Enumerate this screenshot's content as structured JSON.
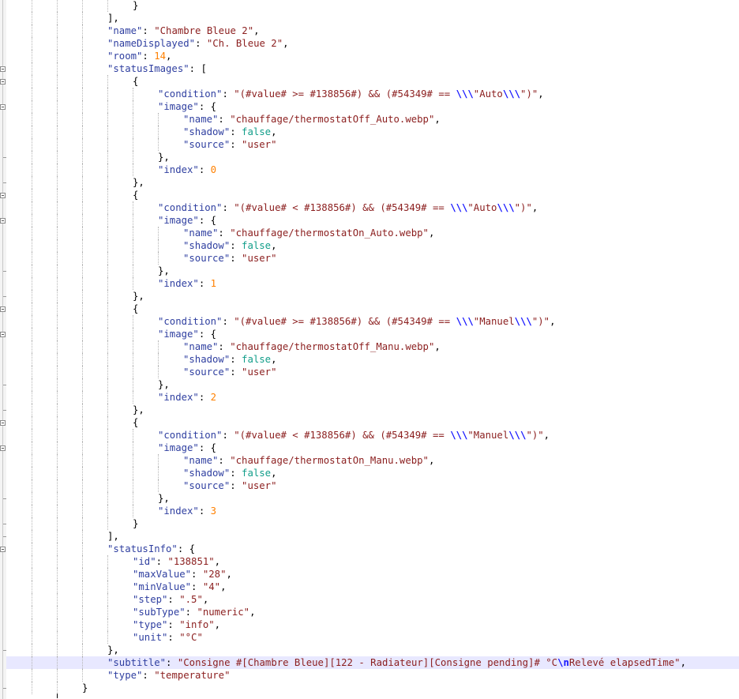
{
  "editor": {
    "language": "json",
    "lines": [
      {
        "fold": "none",
        "hl": false,
        "tokens": [
          {
            "t": "p",
            "v": "}"
          }
        ]
      },
      {
        "fold": "none",
        "hl": false,
        "tokens": [
          {
            "t": "p",
            "v": "],"
          }
        ]
      },
      {
        "fold": "none",
        "hl": false,
        "tokens": [
          {
            "t": "k",
            "v": "\"name\""
          },
          {
            "t": "p",
            "v": ": "
          },
          {
            "t": "s",
            "v": "\"Chambre Bleue 2\""
          },
          {
            "t": "p",
            "v": ","
          }
        ]
      },
      {
        "fold": "none",
        "hl": false,
        "tokens": [
          {
            "t": "k",
            "v": "\"nameDisplayed\""
          },
          {
            "t": "p",
            "v": ": "
          },
          {
            "t": "s",
            "v": "\"Ch. Bleue 2\""
          },
          {
            "t": "p",
            "v": ","
          }
        ]
      },
      {
        "fold": "none",
        "hl": false,
        "tokens": [
          {
            "t": "k",
            "v": "\"room\""
          },
          {
            "t": "p",
            "v": ": "
          },
          {
            "t": "n",
            "v": "14"
          },
          {
            "t": "p",
            "v": ","
          }
        ]
      },
      {
        "fold": "open",
        "hl": false,
        "tokens": [
          {
            "t": "k",
            "v": "\"statusImages\""
          },
          {
            "t": "p",
            "v": ": ["
          }
        ]
      },
      {
        "fold": "open",
        "hl": false,
        "tokens": [
          {
            "t": "p",
            "v": "{"
          }
        ]
      },
      {
        "fold": "none",
        "hl": false,
        "tokens": [
          {
            "t": "k",
            "v": "\"condition\""
          },
          {
            "t": "p",
            "v": ": "
          },
          {
            "t": "s",
            "v": "\"(#value# >= #138856#) && (#54349# == "
          },
          {
            "t": "e",
            "v": "\\\\\\"
          },
          {
            "t": "s",
            "v": "\"Auto"
          },
          {
            "t": "e",
            "v": "\\\\\\"
          },
          {
            "t": "s",
            "v": "\")\""
          },
          {
            "t": "p",
            "v": ","
          }
        ]
      },
      {
        "fold": "open",
        "hl": false,
        "tokens": [
          {
            "t": "k",
            "v": "\"image\""
          },
          {
            "t": "p",
            "v": ": {"
          }
        ]
      },
      {
        "fold": "none",
        "hl": false,
        "tokens": [
          {
            "t": "k",
            "v": "\"name\""
          },
          {
            "t": "p",
            "v": ": "
          },
          {
            "t": "s",
            "v": "\"chauffage/thermostatOff_Auto.webp\""
          },
          {
            "t": "p",
            "v": ","
          }
        ]
      },
      {
        "fold": "none",
        "hl": false,
        "tokens": [
          {
            "t": "k",
            "v": "\"shadow\""
          },
          {
            "t": "p",
            "v": ": "
          },
          {
            "t": "b",
            "v": "false"
          },
          {
            "t": "p",
            "v": ","
          }
        ]
      },
      {
        "fold": "none",
        "hl": false,
        "tokens": [
          {
            "t": "k",
            "v": "\"source\""
          },
          {
            "t": "p",
            "v": ": "
          },
          {
            "t": "s",
            "v": "\"user\""
          }
        ]
      },
      {
        "fold": "close",
        "hl": false,
        "tokens": [
          {
            "t": "p",
            "v": "},"
          }
        ]
      },
      {
        "fold": "none",
        "hl": false,
        "tokens": [
          {
            "t": "k",
            "v": "\"index\""
          },
          {
            "t": "p",
            "v": ": "
          },
          {
            "t": "n",
            "v": "0"
          }
        ]
      },
      {
        "fold": "close",
        "hl": false,
        "tokens": [
          {
            "t": "p",
            "v": "},"
          }
        ]
      },
      {
        "fold": "open",
        "hl": false,
        "tokens": [
          {
            "t": "p",
            "v": "{"
          }
        ]
      },
      {
        "fold": "none",
        "hl": false,
        "tokens": [
          {
            "t": "k",
            "v": "\"condition\""
          },
          {
            "t": "p",
            "v": ": "
          },
          {
            "t": "s",
            "v": "\"(#value# < #138856#) && (#54349# == "
          },
          {
            "t": "e",
            "v": "\\\\\\"
          },
          {
            "t": "s",
            "v": "\"Auto"
          },
          {
            "t": "e",
            "v": "\\\\\\"
          },
          {
            "t": "s",
            "v": "\")\""
          },
          {
            "t": "p",
            "v": ","
          }
        ]
      },
      {
        "fold": "open",
        "hl": false,
        "tokens": [
          {
            "t": "k",
            "v": "\"image\""
          },
          {
            "t": "p",
            "v": ": {"
          }
        ]
      },
      {
        "fold": "none",
        "hl": false,
        "tokens": [
          {
            "t": "k",
            "v": "\"name\""
          },
          {
            "t": "p",
            "v": ": "
          },
          {
            "t": "s",
            "v": "\"chauffage/thermostatOn_Auto.webp\""
          },
          {
            "t": "p",
            "v": ","
          }
        ]
      },
      {
        "fold": "none",
        "hl": false,
        "tokens": [
          {
            "t": "k",
            "v": "\"shadow\""
          },
          {
            "t": "p",
            "v": ": "
          },
          {
            "t": "b",
            "v": "false"
          },
          {
            "t": "p",
            "v": ","
          }
        ]
      },
      {
        "fold": "none",
        "hl": false,
        "tokens": [
          {
            "t": "k",
            "v": "\"source\""
          },
          {
            "t": "p",
            "v": ": "
          },
          {
            "t": "s",
            "v": "\"user\""
          }
        ]
      },
      {
        "fold": "close",
        "hl": false,
        "tokens": [
          {
            "t": "p",
            "v": "},"
          }
        ]
      },
      {
        "fold": "none",
        "hl": false,
        "tokens": [
          {
            "t": "k",
            "v": "\"index\""
          },
          {
            "t": "p",
            "v": ": "
          },
          {
            "t": "n",
            "v": "1"
          }
        ]
      },
      {
        "fold": "close",
        "hl": false,
        "tokens": [
          {
            "t": "p",
            "v": "},"
          }
        ]
      },
      {
        "fold": "open",
        "hl": false,
        "tokens": [
          {
            "t": "p",
            "v": "{"
          }
        ]
      },
      {
        "fold": "none",
        "hl": false,
        "tokens": [
          {
            "t": "k",
            "v": "\"condition\""
          },
          {
            "t": "p",
            "v": ": "
          },
          {
            "t": "s",
            "v": "\"(#value# >= #138856#) && (#54349# == "
          },
          {
            "t": "e",
            "v": "\\\\\\"
          },
          {
            "t": "s",
            "v": "\"Manuel"
          },
          {
            "t": "e",
            "v": "\\\\\\"
          },
          {
            "t": "s",
            "v": "\")\""
          },
          {
            "t": "p",
            "v": ","
          }
        ]
      },
      {
        "fold": "open",
        "hl": false,
        "tokens": [
          {
            "t": "k",
            "v": "\"image\""
          },
          {
            "t": "p",
            "v": ": {"
          }
        ]
      },
      {
        "fold": "none",
        "hl": false,
        "tokens": [
          {
            "t": "k",
            "v": "\"name\""
          },
          {
            "t": "p",
            "v": ": "
          },
          {
            "t": "s",
            "v": "\"chauffage/thermostatOff_Manu.webp\""
          },
          {
            "t": "p",
            "v": ","
          }
        ]
      },
      {
        "fold": "none",
        "hl": false,
        "tokens": [
          {
            "t": "k",
            "v": "\"shadow\""
          },
          {
            "t": "p",
            "v": ": "
          },
          {
            "t": "b",
            "v": "false"
          },
          {
            "t": "p",
            "v": ","
          }
        ]
      },
      {
        "fold": "none",
        "hl": false,
        "tokens": [
          {
            "t": "k",
            "v": "\"source\""
          },
          {
            "t": "p",
            "v": ": "
          },
          {
            "t": "s",
            "v": "\"user\""
          }
        ]
      },
      {
        "fold": "close",
        "hl": false,
        "tokens": [
          {
            "t": "p",
            "v": "},"
          }
        ]
      },
      {
        "fold": "none",
        "hl": false,
        "tokens": [
          {
            "t": "k",
            "v": "\"index\""
          },
          {
            "t": "p",
            "v": ": "
          },
          {
            "t": "n",
            "v": "2"
          }
        ]
      },
      {
        "fold": "close",
        "hl": false,
        "tokens": [
          {
            "t": "p",
            "v": "},"
          }
        ]
      },
      {
        "fold": "open",
        "hl": false,
        "tokens": [
          {
            "t": "p",
            "v": "{"
          }
        ]
      },
      {
        "fold": "none",
        "hl": false,
        "tokens": [
          {
            "t": "k",
            "v": "\"condition\""
          },
          {
            "t": "p",
            "v": ": "
          },
          {
            "t": "s",
            "v": "\"(#value# < #138856#) && (#54349# == "
          },
          {
            "t": "e",
            "v": "\\\\\\"
          },
          {
            "t": "s",
            "v": "\"Manuel"
          },
          {
            "t": "e",
            "v": "\\\\\\"
          },
          {
            "t": "s",
            "v": "\")\""
          },
          {
            "t": "p",
            "v": ","
          }
        ]
      },
      {
        "fold": "open",
        "hl": false,
        "tokens": [
          {
            "t": "k",
            "v": "\"image\""
          },
          {
            "t": "p",
            "v": ": {"
          }
        ]
      },
      {
        "fold": "none",
        "hl": false,
        "tokens": [
          {
            "t": "k",
            "v": "\"name\""
          },
          {
            "t": "p",
            "v": ": "
          },
          {
            "t": "s",
            "v": "\"chauffage/thermostatOn_Manu.webp\""
          },
          {
            "t": "p",
            "v": ","
          }
        ]
      },
      {
        "fold": "none",
        "hl": false,
        "tokens": [
          {
            "t": "k",
            "v": "\"shadow\""
          },
          {
            "t": "p",
            "v": ": "
          },
          {
            "t": "b",
            "v": "false"
          },
          {
            "t": "p",
            "v": ","
          }
        ]
      },
      {
        "fold": "none",
        "hl": false,
        "tokens": [
          {
            "t": "k",
            "v": "\"source\""
          },
          {
            "t": "p",
            "v": ": "
          },
          {
            "t": "s",
            "v": "\"user\""
          }
        ]
      },
      {
        "fold": "close",
        "hl": false,
        "tokens": [
          {
            "t": "p",
            "v": "},"
          }
        ]
      },
      {
        "fold": "none",
        "hl": false,
        "tokens": [
          {
            "t": "k",
            "v": "\"index\""
          },
          {
            "t": "p",
            "v": ": "
          },
          {
            "t": "n",
            "v": "3"
          }
        ]
      },
      {
        "fold": "close",
        "hl": false,
        "tokens": [
          {
            "t": "p",
            "v": "}"
          }
        ]
      },
      {
        "fold": "close",
        "hl": false,
        "tokens": [
          {
            "t": "p",
            "v": "],"
          }
        ]
      },
      {
        "fold": "open",
        "hl": false,
        "tokens": [
          {
            "t": "k",
            "v": "\"statusInfo\""
          },
          {
            "t": "p",
            "v": ": {"
          }
        ]
      },
      {
        "fold": "none",
        "hl": false,
        "tokens": [
          {
            "t": "k",
            "v": "\"id\""
          },
          {
            "t": "p",
            "v": ": "
          },
          {
            "t": "s",
            "v": "\"138851\""
          },
          {
            "t": "p",
            "v": ","
          }
        ]
      },
      {
        "fold": "none",
        "hl": false,
        "tokens": [
          {
            "t": "k",
            "v": "\"maxValue\""
          },
          {
            "t": "p",
            "v": ": "
          },
          {
            "t": "s",
            "v": "\"28\""
          },
          {
            "t": "p",
            "v": ","
          }
        ]
      },
      {
        "fold": "none",
        "hl": false,
        "tokens": [
          {
            "t": "k",
            "v": "\"minValue\""
          },
          {
            "t": "p",
            "v": ": "
          },
          {
            "t": "s",
            "v": "\"4\""
          },
          {
            "t": "p",
            "v": ","
          }
        ]
      },
      {
        "fold": "none",
        "hl": false,
        "tokens": [
          {
            "t": "k",
            "v": "\"step\""
          },
          {
            "t": "p",
            "v": ": "
          },
          {
            "t": "s",
            "v": "\".5\""
          },
          {
            "t": "p",
            "v": ","
          }
        ]
      },
      {
        "fold": "none",
        "hl": false,
        "tokens": [
          {
            "t": "k",
            "v": "\"subType\""
          },
          {
            "t": "p",
            "v": ": "
          },
          {
            "t": "s",
            "v": "\"numeric\""
          },
          {
            "t": "p",
            "v": ","
          }
        ]
      },
      {
        "fold": "none",
        "hl": false,
        "tokens": [
          {
            "t": "k",
            "v": "\"type\""
          },
          {
            "t": "p",
            "v": ": "
          },
          {
            "t": "s",
            "v": "\"info\""
          },
          {
            "t": "p",
            "v": ","
          }
        ]
      },
      {
        "fold": "none",
        "hl": false,
        "tokens": [
          {
            "t": "k",
            "v": "\"unit\""
          },
          {
            "t": "p",
            "v": ": "
          },
          {
            "t": "s",
            "v": "\"°C\""
          }
        ]
      },
      {
        "fold": "close",
        "hl": false,
        "tokens": [
          {
            "t": "p",
            "v": "},"
          }
        ]
      },
      {
        "fold": "none",
        "hl": true,
        "tokens": [
          {
            "t": "k",
            "v": "\"subtitle\""
          },
          {
            "t": "p",
            "v": ": "
          },
          {
            "t": "s",
            "v": "\"Consigne #[Chambre Bleue][122 - Radiateur][Consigne pending]# °C"
          },
          {
            "t": "e",
            "v": "\\n"
          },
          {
            "t": "s",
            "v": "Relevé elapsedTime\""
          },
          {
            "t": "p",
            "v": ","
          }
        ]
      },
      {
        "fold": "none",
        "hl": false,
        "tokens": [
          {
            "t": "k",
            "v": "\"type\""
          },
          {
            "t": "p",
            "v": ": "
          },
          {
            "t": "s",
            "v": "\"temperature\""
          }
        ]
      },
      {
        "fold": "close",
        "hl": false,
        "tokens": [
          {
            "t": "p",
            "v": "}"
          }
        ]
      }
    ]
  }
}
